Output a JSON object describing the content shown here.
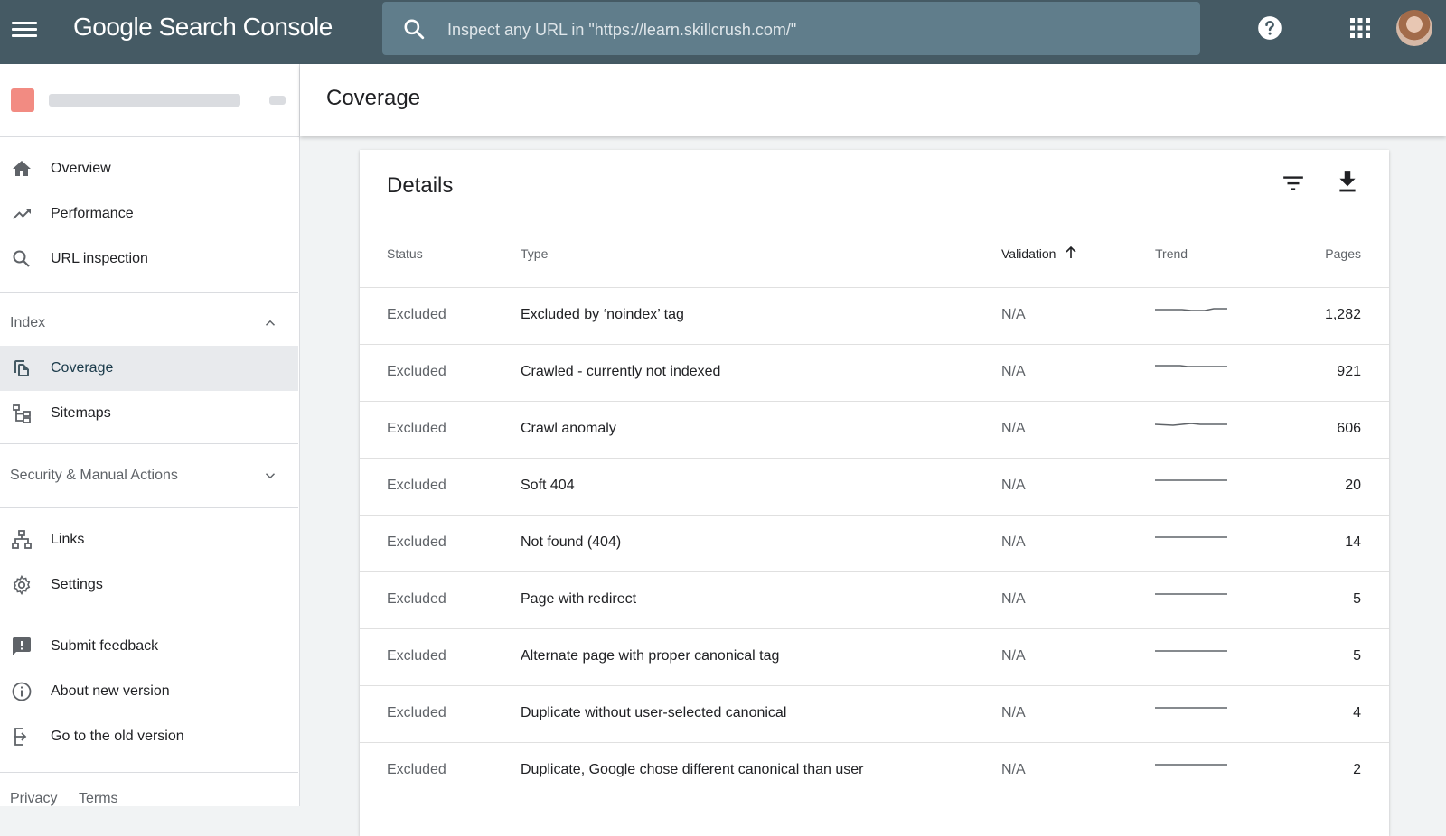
{
  "topbar": {
    "logo": "Google Search Console",
    "search_placeholder": "Inspect any URL in \"https://learn.skillcrush.com/\""
  },
  "sidebar": {
    "top_items": [
      {
        "label": "Overview",
        "icon": "home-icon"
      },
      {
        "label": "Performance",
        "icon": "trending-up-icon"
      },
      {
        "label": "URL inspection",
        "icon": "search-icon"
      }
    ],
    "index_section": {
      "label": "Index",
      "items": [
        {
          "label": "Coverage",
          "icon": "coverage-icon",
          "active": true
        },
        {
          "label": "Sitemaps",
          "icon": "sitemap-icon"
        }
      ]
    },
    "security_section": {
      "label": "Security & Manual Actions"
    },
    "bottom_items": [
      {
        "label": "Links",
        "icon": "links-icon"
      },
      {
        "label": "Settings",
        "icon": "gear-icon"
      },
      {
        "label": "Submit feedback",
        "icon": "feedback-icon"
      },
      {
        "label": "About new version",
        "icon": "info-icon"
      },
      {
        "label": "Go to the old version",
        "icon": "exit-icon"
      }
    ],
    "footer": {
      "privacy": "Privacy",
      "terms": "Terms"
    }
  },
  "page": {
    "title": "Coverage"
  },
  "details": {
    "title": "Details",
    "columns": {
      "status": "Status",
      "type": "Type",
      "validation": "Validation",
      "trend": "Trend",
      "pages": "Pages"
    },
    "rows": [
      {
        "status": "Excluded",
        "type": "Excluded by ‘noindex’ tag",
        "validation": "N/A",
        "pages": "1,282"
      },
      {
        "status": "Excluded",
        "type": "Crawled - currently not indexed",
        "validation": "N/A",
        "pages": "921"
      },
      {
        "status": "Excluded",
        "type": "Crawl anomaly",
        "validation": "N/A",
        "pages": "606"
      },
      {
        "status": "Excluded",
        "type": "Soft 404",
        "validation": "N/A",
        "pages": "20"
      },
      {
        "status": "Excluded",
        "type": "Not found (404)",
        "validation": "N/A",
        "pages": "14"
      },
      {
        "status": "Excluded",
        "type": "Page with redirect",
        "validation": "N/A",
        "pages": "5"
      },
      {
        "status": "Excluded",
        "type": "Alternate page with proper canonical tag",
        "validation": "N/A",
        "pages": "5"
      },
      {
        "status": "Excluded",
        "type": "Duplicate without user-selected canonical",
        "validation": "N/A",
        "pages": "4"
      },
      {
        "status": "Excluded",
        "type": "Duplicate, Google chose different canonical than user",
        "validation": "N/A",
        "pages": "2"
      }
    ]
  },
  "colors": {
    "topbar": "#455a64",
    "search": "#607d8b",
    "active_nav": "#e8eaed"
  }
}
